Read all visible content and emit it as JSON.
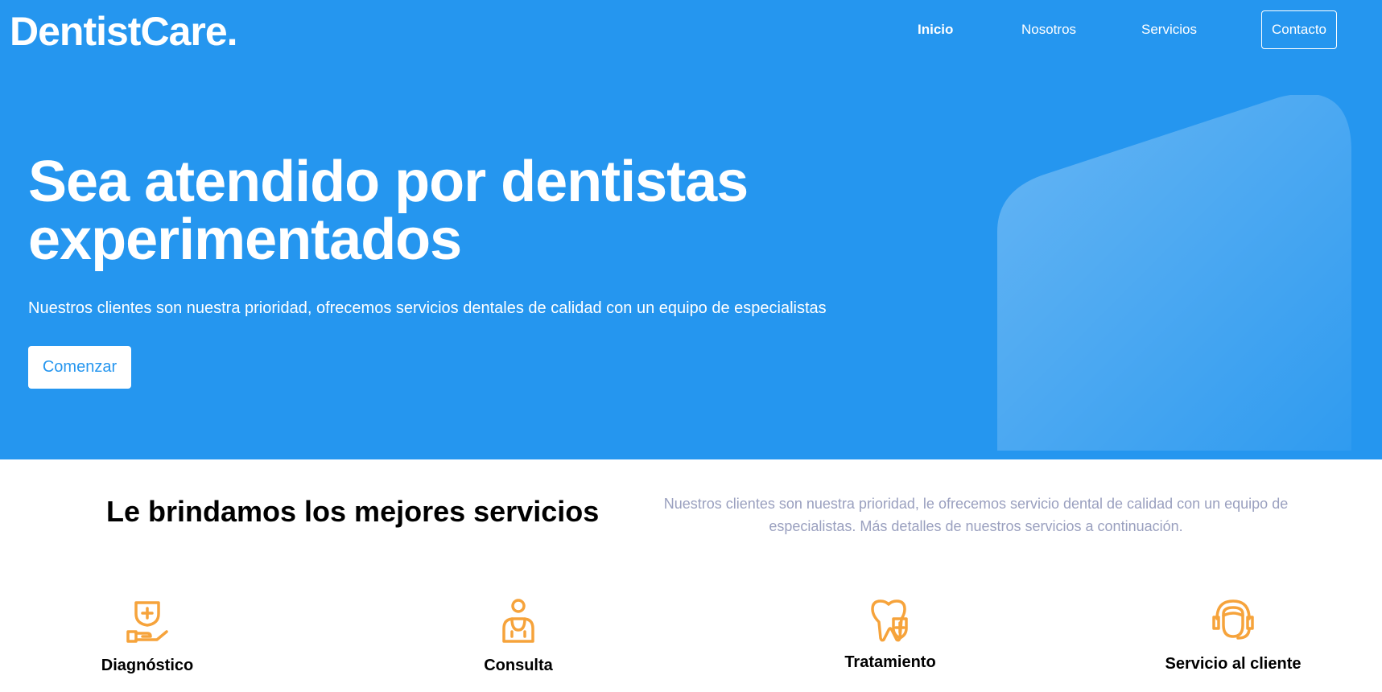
{
  "brand": {
    "logo": "DentistCare."
  },
  "nav": {
    "home": "Inicio",
    "about": "Nosotros",
    "services": "Servicios",
    "contact": "Contacto"
  },
  "hero": {
    "title": "Sea atendido por dentistas experimentados",
    "subtitle": "Nuestros clientes son nuestra prioridad, ofrecemos servicios dentales de calidad con un equipo de especialistas",
    "cta": "Comenzar"
  },
  "services": {
    "heading": "Le brindamos los mejores servicios",
    "description": "Nuestros clientes son nuestra prioridad, le ofrecemos servicio dental de calidad con un equipo de especialistas. Más detalles de nuestros servicios a continuación.",
    "items": [
      {
        "label": "Diagnóstico",
        "icon": "hand-medical-icon"
      },
      {
        "label": "Consulta",
        "icon": "doctor-icon"
      },
      {
        "label": "Tratamiento",
        "icon": "tooth-plus-icon"
      },
      {
        "label": "Servicio al cliente",
        "icon": "headset-agent-icon"
      }
    ]
  },
  "colors": {
    "primary": "#2596ef",
    "accent": "#f6a33b",
    "muted_text": "#9aa0bf"
  }
}
